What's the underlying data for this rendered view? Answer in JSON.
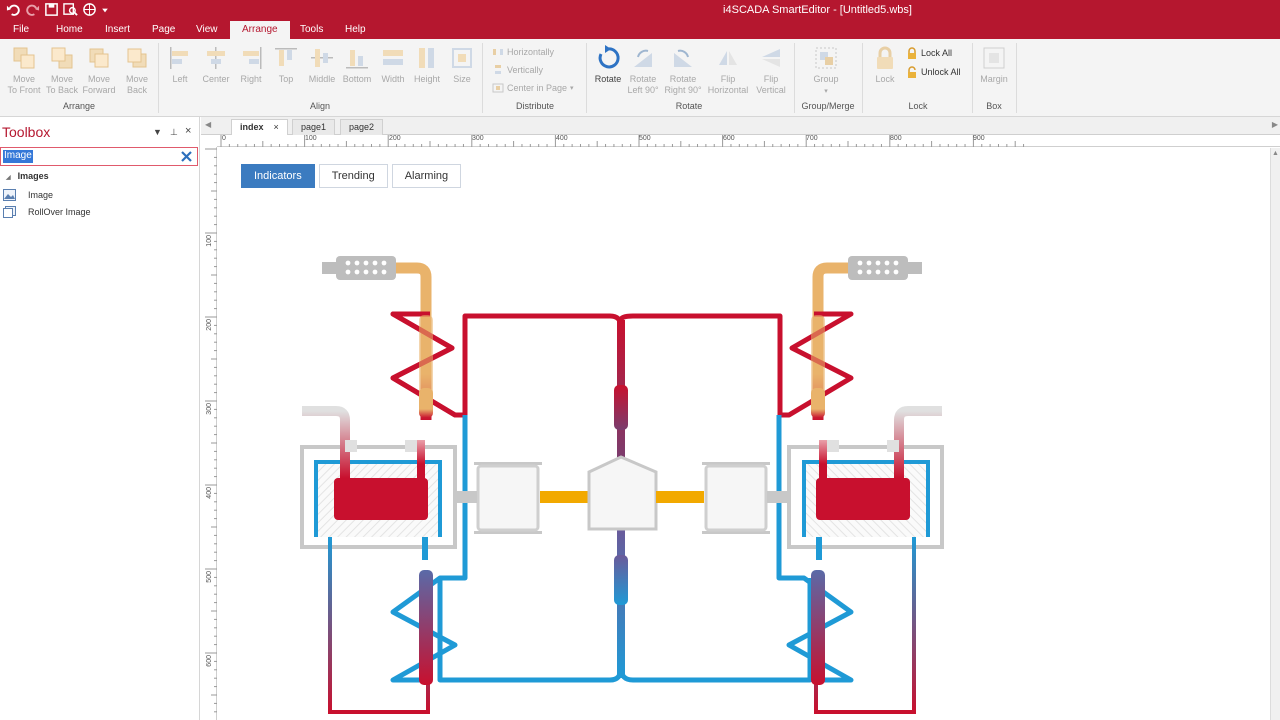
{
  "app": {
    "title": "i4SCADA SmartEditor - [Untitled5.wbs]"
  },
  "quick_access": {
    "icons": [
      "undo-icon",
      "redo-icon",
      "save-icon",
      "preview-icon",
      "globe-icon"
    ]
  },
  "menu": {
    "items": [
      {
        "label": "File"
      },
      {
        "label": "Home"
      },
      {
        "label": "Insert"
      },
      {
        "label": "Page"
      },
      {
        "label": "View"
      },
      {
        "label": "Arrange"
      },
      {
        "label": "Tools"
      },
      {
        "label": "Help"
      }
    ],
    "active": "Arrange"
  },
  "ribbon": {
    "arrange": {
      "label": "Arrange",
      "buttons": [
        {
          "line1": "Move",
          "line2": "To Front"
        },
        {
          "line1": "Move",
          "line2": "To Back"
        },
        {
          "line1": "Move",
          "line2": "Forward"
        },
        {
          "line1": "Move",
          "line2": "Back"
        }
      ]
    },
    "align": {
      "label": "Align",
      "buttons": [
        "Left",
        "Center",
        "Right",
        "Top",
        "Middle",
        "Bottom",
        "Width",
        "Height",
        "Size"
      ]
    },
    "distribute": {
      "label": "Distribute",
      "buttons": [
        "Horizontally",
        "Vertically",
        "Center in Page"
      ]
    },
    "rotate": {
      "label": "Rotate",
      "buttons": [
        {
          "line1": "Rotate",
          "line2": ""
        },
        {
          "line1": "Rotate",
          "line2": "Left 90°"
        },
        {
          "line1": "Rotate",
          "line2": "Right 90°"
        },
        {
          "line1": "Flip",
          "line2": "Horizontal"
        },
        {
          "line1": "Flip",
          "line2": "Vertical"
        }
      ]
    },
    "group": {
      "label": "Group/Merge",
      "buttons": [
        "Group"
      ]
    },
    "lock": {
      "label": "Lock",
      "buttons": [
        "Lock",
        "Lock All",
        "Unlock All"
      ]
    },
    "box": {
      "label": "Box",
      "buttons": [
        "Margin"
      ]
    }
  },
  "toolbox": {
    "title": "Toolbox",
    "search_value": "Image",
    "group": "Images",
    "items": [
      {
        "label": "Image",
        "icon": "image-icon"
      },
      {
        "label": "RollOver Image",
        "icon": "rollover-image-icon"
      }
    ]
  },
  "doc_tabs": [
    {
      "label": "index",
      "active": true
    },
    {
      "label": "page1",
      "active": false
    },
    {
      "label": "page2",
      "active": false
    }
  ],
  "rulers": {
    "horizontal": [
      "0",
      "100",
      "200",
      "300",
      "400",
      "500",
      "600",
      "700",
      "800",
      "900"
    ],
    "vertical": [
      "100",
      "200",
      "300",
      "400",
      "500",
      "600"
    ]
  },
  "canvas": {
    "page_tabs": [
      {
        "label": "Indicators",
        "active": true
      },
      {
        "label": "Trending",
        "active": false
      },
      {
        "label": "Alarming",
        "active": false
      }
    ]
  },
  "colors": {
    "brand": "#b5172f",
    "hot": "#c8102e",
    "cold": "#1f9ad6",
    "warm": "#e9b36b",
    "active_tab": "#3b7bc0",
    "link": "#f2a900"
  }
}
